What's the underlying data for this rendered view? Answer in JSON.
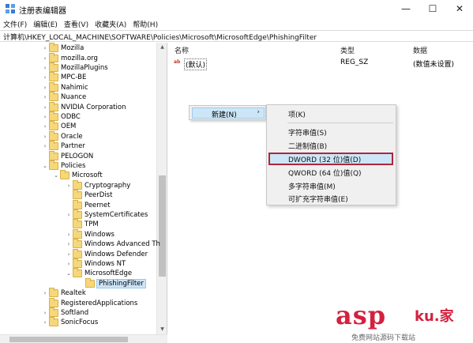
{
  "window": {
    "title": "注册表编辑器",
    "minimize": "—",
    "maximize": "☐",
    "close": "✕"
  },
  "menu": [
    "文件(F)",
    "编辑(E)",
    "查看(V)",
    "收藏夹(A)",
    "帮助(H)"
  ],
  "address": "计算机\\HKEY_LOCAL_MACHINE\\SOFTWARE\\Policies\\Microsoft\\MicrosoftEdge\\PhishingFilter",
  "tree": [
    {
      "label": "Mozilla",
      "level": 0,
      "arrow": "›"
    },
    {
      "label": "mozilla.org",
      "level": 0,
      "arrow": "›"
    },
    {
      "label": "MozillaPlugins",
      "level": 0,
      "arrow": "›"
    },
    {
      "label": "MPC-BE",
      "level": 0,
      "arrow": "›"
    },
    {
      "label": "Nahimic",
      "level": 0,
      "arrow": "›"
    },
    {
      "label": "Nuance",
      "level": 0,
      "arrow": "›"
    },
    {
      "label": "NVIDIA Corporation",
      "level": 0,
      "arrow": "›"
    },
    {
      "label": "ODBC",
      "level": 0,
      "arrow": "›"
    },
    {
      "label": "OEM",
      "level": 0,
      "arrow": "›"
    },
    {
      "label": "Oracle",
      "level": 0,
      "arrow": "›"
    },
    {
      "label": "Partner",
      "level": 0,
      "arrow": "›"
    },
    {
      "label": "PELOGON",
      "level": 0,
      "arrow": ""
    },
    {
      "label": "Policies",
      "level": 0,
      "arrow": "⌄"
    },
    {
      "label": "Microsoft",
      "level": 1,
      "arrow": "⌄"
    },
    {
      "label": "Cryptography",
      "level": 2,
      "arrow": "›"
    },
    {
      "label": "PeerDist",
      "level": 2,
      "arrow": ""
    },
    {
      "label": "Peernet",
      "level": 2,
      "arrow": ""
    },
    {
      "label": "SystemCertificates",
      "level": 2,
      "arrow": "›"
    },
    {
      "label": "TPM",
      "level": 2,
      "arrow": ""
    },
    {
      "label": "Windows",
      "level": 2,
      "arrow": "›"
    },
    {
      "label": "Windows Advanced Th",
      "level": 2,
      "arrow": "›"
    },
    {
      "label": "Windows Defender",
      "level": 2,
      "arrow": "›"
    },
    {
      "label": "Windows NT",
      "level": 2,
      "arrow": "›"
    },
    {
      "label": "MicrosoftEdge",
      "level": 2,
      "arrow": "⌄"
    },
    {
      "label": "PhishingFilter",
      "level": 3,
      "arrow": "",
      "selected": true
    },
    {
      "label": "Realtek",
      "level": 0,
      "arrow": "›"
    },
    {
      "label": "RegisteredApplications",
      "level": 0,
      "arrow": ""
    },
    {
      "label": "Softland",
      "level": 0,
      "arrow": "›"
    },
    {
      "label": "SonicFocus",
      "level": 0,
      "arrow": "›"
    }
  ],
  "list": {
    "headers": {
      "name": "名称",
      "type": "类型",
      "data": "数据"
    },
    "rows": [
      {
        "icon": "ab",
        "name": "(默认)",
        "type": "REG_SZ",
        "data": "(数值未设置)"
      }
    ]
  },
  "context_menu": {
    "new_label": "新建(N)",
    "submenu_arrow": "›",
    "items": [
      {
        "label": "项(K)"
      },
      {
        "label": "字符串值(S)"
      },
      {
        "label": "二进制值(B)"
      },
      {
        "label": "DWORD (32 位)值(D)",
        "highlighted": true
      },
      {
        "label": "QWORD (64 位)值(Q)"
      },
      {
        "label": "多字符串值(M)"
      },
      {
        "label": "可扩充字符串值(E)"
      }
    ]
  },
  "watermark": {
    "brand": "asp",
    "cn": "ku.家",
    "sub": "免费网站源码下载站"
  },
  "colors": {
    "accent_red": "#d4213f",
    "highlight": "#cde6f7",
    "folder": "#f6d77a"
  }
}
